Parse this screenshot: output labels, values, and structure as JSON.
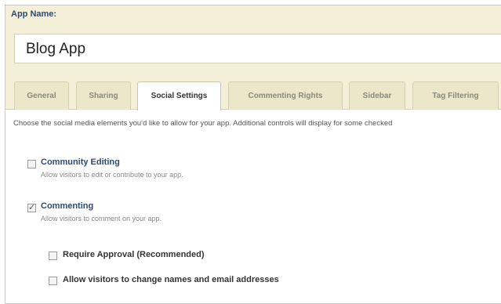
{
  "app_name": {
    "label": "App Name:",
    "value": "Blog App"
  },
  "tabs": [
    {
      "label": "General",
      "active": false
    },
    {
      "label": "Sharing",
      "active": false
    },
    {
      "label": "Social Settings",
      "active": true
    },
    {
      "label": "Commenting Rights",
      "active": false
    },
    {
      "label": "Sidebar",
      "active": false
    },
    {
      "label": "Tag Filtering",
      "active": false
    }
  ],
  "intro_text": "Choose the social media elements you'd like to allow for your app. Additional controls will display for some checked",
  "options": {
    "community_editing": {
      "title": "Community Editing",
      "description": "Allow visitors to edit or contribute to your app.",
      "checked": false
    },
    "commenting": {
      "title": "Commenting",
      "description": "Allow visitors to comment on your app.",
      "checked": true,
      "suboptions": {
        "require_approval": {
          "label": "Require Approval (Recommended)",
          "checked": false
        },
        "allow_change_names": {
          "label": "Allow visitors to change names and email addresses",
          "checked": false
        }
      }
    }
  },
  "colors": {
    "header_bg": "#f3f0d7",
    "label_blue": "#2d4a73"
  }
}
